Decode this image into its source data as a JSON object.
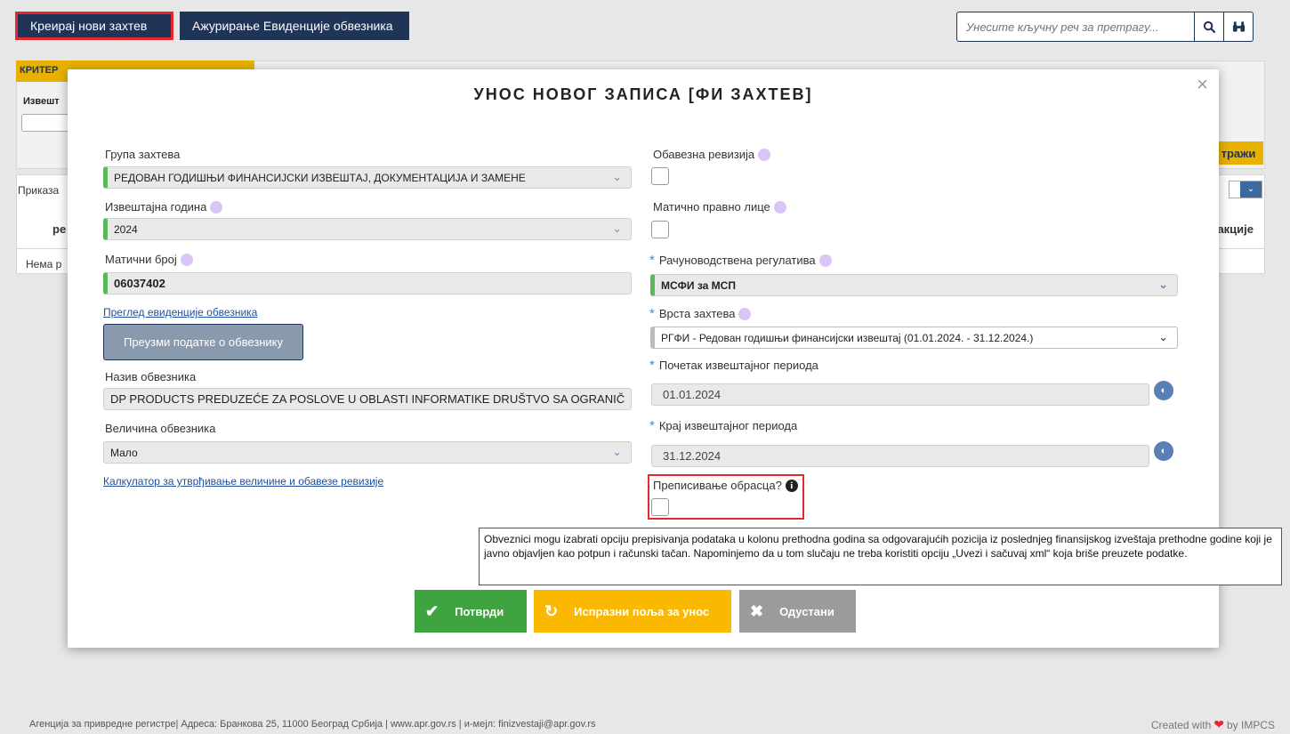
{
  "topbar": {
    "create_label": "Креирај нови захтев",
    "update_label": "Ажурирање Евиденције обвезника",
    "search_placeholder": "Унесите кључну реч за претрагу..."
  },
  "background": {
    "criteria_tab": "КРИТЕР",
    "criteria_label": "Извешт",
    "search_btn": "тражи",
    "show_label": "Приказа",
    "col_left": "ре",
    "col_right": "акције",
    "no_results": "Нема р"
  },
  "modal": {
    "title": "УНОС НОВОГ ЗАПИСА [ФИ ЗАХТЕВ]",
    "close": "×",
    "left": {
      "group_label": "Група захтева",
      "group_value": "РЕДОВАН ГОДИШЊИ ФИНАНСИЈСКИ ИЗВЕШТАЈ, ДОКУМЕНТАЦИЈА И ЗАМЕНЕ",
      "year_label": "Извештајна година",
      "year_value": "2024",
      "reg_label": "Матични број",
      "reg_value": "06037402",
      "registry_link": "Преглед евиденције обвезника",
      "fetch_button": "Преузми податке о обвезнику",
      "name_label": "Назив обвезника",
      "name_value": "DP PRODUCTS PREDUZEĆE ZA POSLOVE U OBLASTI INFORMATIKE DRUŠTVO SA OGRANIČ",
      "size_label": "Величина обвезника",
      "size_value": "Мало",
      "calc_link": "Калкулатор за утврђивање величине и обавезе ревизије"
    },
    "right": {
      "audit_label": "Обавезна ревизија",
      "parent_label": "Матично правно лице",
      "reg_label": "Рачуноводствена регулатива",
      "reg_value": "МСФИ за МСП",
      "type_label": "Врста захтева",
      "type_value": "РГФИ - Редован годишњи финансијски извештај (01.01.2024. - 31.12.2024.)",
      "start_label": "Почетак извештајног периода",
      "start_value": "01.01.2024",
      "end_label": "Крај извештајног периода",
      "end_value": "31.12.2024",
      "copy_label": "Преписивање обрасца?"
    },
    "tooltip": "Obveznici mogu izabrati opciju prepisivanja podataka u kolonu prethodna godina sa odgovarajućih pozicija iz poslednjeg finansijskog izveštaja prethodne godine koji je javno objavljen kao potpun i računski tačan. Napominjemo da u tom slučaju ne treba koristiti opciju „Uvezi i sačuvaj xml“ koja briše preuzete podatke.",
    "buttons": {
      "confirm": "Потврди",
      "clear": "Испразни поља за унос",
      "cancel": "Одустани"
    }
  },
  "footer": {
    "left": "Агенција за привредне регистре| Адреса: Бранкова 25, 11000 Београд Србија | www.apr.gov.rs | и-мејл: finizvestaji@apr.gov.rs",
    "created": "Created with",
    "by": "by IMPCS"
  },
  "colors": {
    "navy": "#1f3456",
    "red_highlight": "#e8262d",
    "green": "#3fa33f",
    "yellow": "#fbb800",
    "gray": "#9b9b9b"
  }
}
